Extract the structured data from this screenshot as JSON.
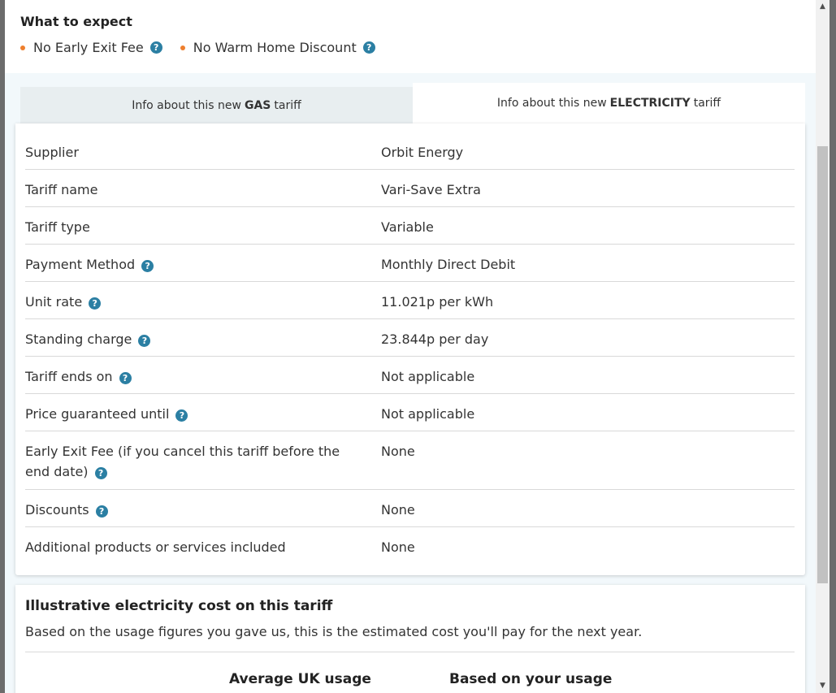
{
  "expect": {
    "title": "What to expect",
    "items": [
      {
        "label": "No Early Exit Fee"
      },
      {
        "label": "No Warm Home Discount"
      }
    ],
    "bullet_color": "#ee7f2d"
  },
  "tabs": [
    {
      "prefix": "Info about this new",
      "bold": "GAS",
      "suffix": "tariff",
      "active": false
    },
    {
      "prefix": "Info about this new",
      "bold": "ELECTRICITY",
      "suffix": "tariff",
      "active": true
    }
  ],
  "tariff_rows": [
    {
      "label": "Supplier",
      "value": "Orbit Energy"
    },
    {
      "label": "Tariff name",
      "value": "Vari-Save Extra"
    },
    {
      "label": "Tariff type",
      "value": "Variable"
    },
    {
      "label": "Payment Method",
      "value": "Monthly Direct Debit"
    },
    {
      "label": "Unit rate",
      "value": "11.021p per kWh"
    },
    {
      "label": "Standing charge",
      "value": "23.844p per day"
    },
    {
      "label": "Tariff ends on",
      "value": "Not applicable"
    },
    {
      "label": "Price guaranteed until",
      "value": "Not applicable"
    },
    {
      "label": "Early Exit Fee (if you cancel this tariff before the end date)",
      "value": "None"
    },
    {
      "label": "Discounts",
      "value": "None"
    },
    {
      "label": "Additional products or services included",
      "value": "None"
    }
  ],
  "cost": {
    "title": "Illustrative electricity cost on this tariff",
    "subtitle": "Based on the usage figures you gave us, this is the estimated cost you'll pay for the next year.",
    "col_average": "Average UK usage",
    "col_yours": "Based on your usage"
  },
  "help_icon": {
    "glyph": "?",
    "color": "#2b7fa3"
  },
  "scrollbar": {
    "up": "▲",
    "down": "▼"
  }
}
